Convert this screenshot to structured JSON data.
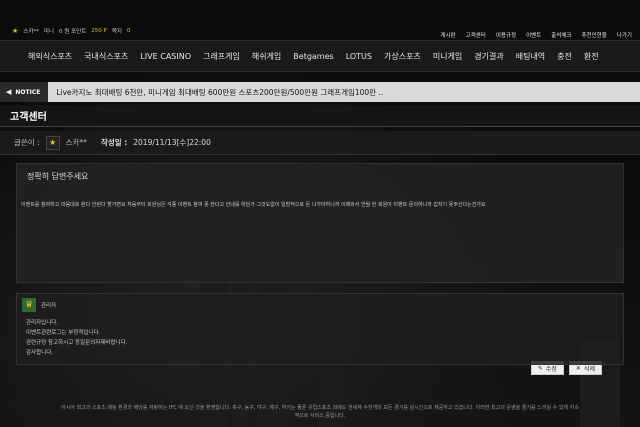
{
  "user": {
    "rank_icon": "star",
    "name": "스카**",
    "level_label": "미니",
    "point_label": "0 원 포인트",
    "money": "250 P",
    "msg_label": "쪽지",
    "msg_count": "0"
  },
  "top_links": [
    "게시판",
    "고객센터",
    "이용규정",
    "이벤트",
    "출석체크",
    "추천인현황",
    "나가기"
  ],
  "nav": [
    "해외식스포츠",
    "국내식스포츠",
    "LIVE CASINO",
    "그래프게임",
    "해쉬게임",
    "Betgames",
    "LOTUS",
    "가상스포츠",
    "미니게임",
    "경기결과",
    "배팅내역",
    "충전",
    "환전"
  ],
  "notice": {
    "tag": "NOTICE",
    "text": "Live카지노 최대배팅 6천만, 미니게임 최대배팅 600만원 스포츠200만원/500만원 그래프게임100만 .."
  },
  "page_title": "고객센터",
  "post": {
    "writer_label": "글쓴이 :",
    "author": "스카**",
    "date_label": "작성일 :",
    "date": "2019/11/13[수]22:00",
    "subject": "정확히 답변주세요",
    "body": "이벤트를 참여하고 마음대로 본다 안된다 할거면요 처음부터 회원님은 각종 이벤트 참여 못 한다고 안내를 하던가 그것도없이 일방적으로 돈 나가야하니까 이제와서 안될 한 회원이 이벤트 문의하니까 갑자기 못주신다는건가요"
  },
  "comment": {
    "badge_icon": "crown",
    "name": "관리자",
    "lines": [
      "관리자입니다.",
      "이벤트관련로그는 부정적입니다.",
      "관련규정 참고하시고 등일문의자제바랍니다.",
      "감사합니다."
    ]
  },
  "buttons": {
    "edit": "수정",
    "delete": "삭제"
  },
  "footer": "아시아 최고의 스포츠 배팅 환경과 배당률 자랑하는 IFC 에 오신 것을 환영합니다. 축구, 농구, 야구, 배구, 하키는 물론 유럽스포츠 외에도 전세계 수천개의 모든 경기를 실시간으로 제공하고 있습니다. 이러한 최고의 운영을 즐기를 느끼실 수 있게 지속적으로 서비스 중입니다."
}
